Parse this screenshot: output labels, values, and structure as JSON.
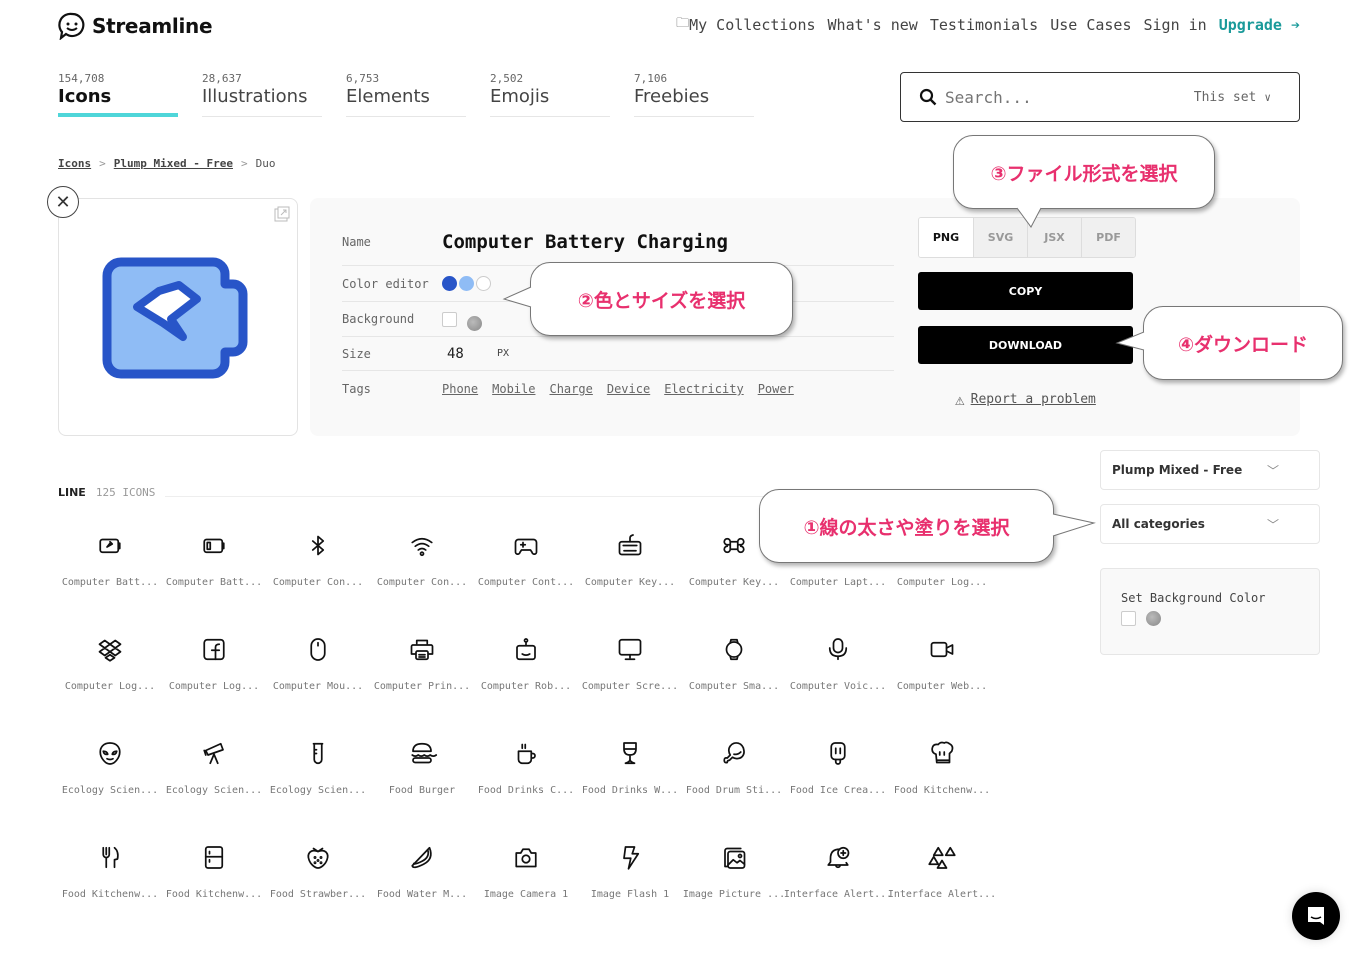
{
  "brand": {
    "name": "Streamline",
    "accent": "#4fd6d9",
    "upgrade_color": "#1a9a9a"
  },
  "topnav": {
    "items": [
      "My Collections",
      "What's new",
      "Testimonials",
      "Use Cases",
      "Sign in"
    ],
    "upgrade": "Upgrade ➔"
  },
  "tabs": [
    {
      "count": "154,708",
      "label": "Icons",
      "active": true
    },
    {
      "count": "28,637",
      "label": "Illustrations"
    },
    {
      "count": "6,753",
      "label": "Elements"
    },
    {
      "count": "2,502",
      "label": "Emojis"
    },
    {
      "count": "7,106",
      "label": "Freebies"
    }
  ],
  "search": {
    "placeholder": "Search...",
    "scope": "This set"
  },
  "breadcrumb": {
    "items": [
      "Icons",
      "Plump Mixed - Free"
    ],
    "current": "Duo",
    "sep": ">"
  },
  "detail": {
    "name_label": "Name",
    "name": "Computer Battery Charging",
    "color_label": "Color editor",
    "colors": [
      "#2855c8",
      "#8fbcf5",
      "#ffffff"
    ],
    "bg_label": "Background",
    "size_label": "Size",
    "size": "48",
    "size_unit": "PX",
    "tags_label": "Tags",
    "tags": [
      "Phone",
      "Mobile",
      "Charge",
      "Device",
      "Electricity",
      "Power"
    ]
  },
  "formats": {
    "options": [
      "PNG",
      "SVG",
      "JSX",
      "PDF"
    ],
    "selected": "PNG"
  },
  "actions": {
    "copy": "COPY",
    "download": "DOWNLOAD",
    "report": "Report a problem"
  },
  "section": {
    "style": "LINE",
    "count": "125 ICONS"
  },
  "filters": {
    "set": "Plump Mixed - Free",
    "category": "All categories",
    "bg_title": "Set Background Color"
  },
  "icons": [
    "Computer Batt...",
    "Computer Batt...",
    "Computer Con...",
    "Computer Con...",
    "Computer Cont...",
    "Computer Key...",
    "Computer Key...",
    "Computer Lapt...",
    "Computer Log...",
    "Computer Log...",
    "Computer Log...",
    "Computer Mou...",
    "Computer Prin...",
    "Computer Rob...",
    "Computer Scre...",
    "Computer Sma...",
    "Computer Voic...",
    "Computer Web...",
    "Ecology Scien...",
    "Ecology Scien...",
    "Ecology Scien...",
    "Food Burger",
    "Food Drinks C...",
    "Food Drinks W...",
    "Food Drum Sti...",
    "Food Ice Crea...",
    "Food Kitchenw...",
    "Food Kitchenw...",
    "Food Kitchenw...",
    "Food Strawber...",
    "Food Water M...",
    "Image Camera 1",
    "Image Flash 1",
    "Image Picture ...",
    "Interface Alert...",
    "Interface Alert..."
  ],
  "annotations": {
    "a1": "①線の太さや塗りを選択",
    "a2": "②色とサイズを選択",
    "a3": "③ファイル形式を選択",
    "a4": "④ダウンロード"
  }
}
